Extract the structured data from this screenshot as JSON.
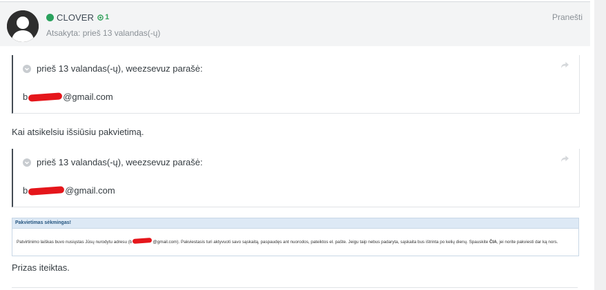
{
  "post": {
    "author": "CLOVER",
    "reputation": "1",
    "meta": "Atsakyta: prieš 13 valandas(-ų)",
    "report_label": "Pranešti",
    "status_color": "#2aa15d"
  },
  "quotes": [
    {
      "citation": "prieš 13 valandas(-ų), weezsevuz parašė:",
      "text_prefix": "b",
      "text_suffix": "@gmail.com"
    },
    {
      "citation": "prieš 13 valandas(-ų), weezsevuz parašė:",
      "text_prefix": "b",
      "text_suffix": "@gmail.com"
    }
  ],
  "body": {
    "line1": "Kai atsikelsiu išsiūsiu pakvietimą.",
    "line2": "Prizas iteiktas."
  },
  "invite": {
    "title": "Pakvietimas sėkmingas!",
    "text_before": "Patvirtinimo laiškas buvo nusiųstas Jūsų nurodytu adresu (b",
    "text_after": "@gmail.com). Pakviestasis turi aktyvuoti savo sąskaitą, paspaudęs ant nuorodos, pateiktos el. pašte. Jeigu taip nebus padaryta, sąskaita bus ištrinta po kelių dienų. Spauskite ",
    "link": "ČIA",
    "text_end": ", jei norite pakviesti dar ką nors."
  }
}
